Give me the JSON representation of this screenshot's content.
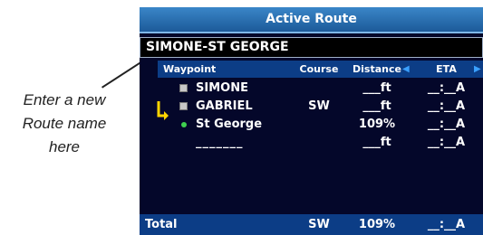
{
  "callout": {
    "lines": [
      "Enter a new",
      "Route name",
      "here"
    ]
  },
  "screen": {
    "title": "Active Route",
    "route_name": "SIMONE-ST GEORGE",
    "columns": {
      "waypoint": "Waypoint",
      "course": "Course",
      "distance": "Distance",
      "eta": "ETA"
    },
    "rows": [
      {
        "name": "SIMONE",
        "icon": "waypoint-flag-icon",
        "course": "",
        "distance": "___ft",
        "eta": "__:__A"
      },
      {
        "name": "GABRIEL",
        "icon": "waypoint-flag-icon",
        "course": "SW",
        "distance": "___ft",
        "eta": "__:__A"
      },
      {
        "name": "St George",
        "icon": "destination-dot-icon",
        "course": "",
        "distance": "109%",
        "eta": "__:__A"
      },
      {
        "name": "_______",
        "icon": "",
        "course": "",
        "distance": "___ft",
        "eta": "__:__A"
      }
    ],
    "total": {
      "label": "Total",
      "course": "SW",
      "distance": "109%",
      "eta": "__:__A"
    }
  }
}
